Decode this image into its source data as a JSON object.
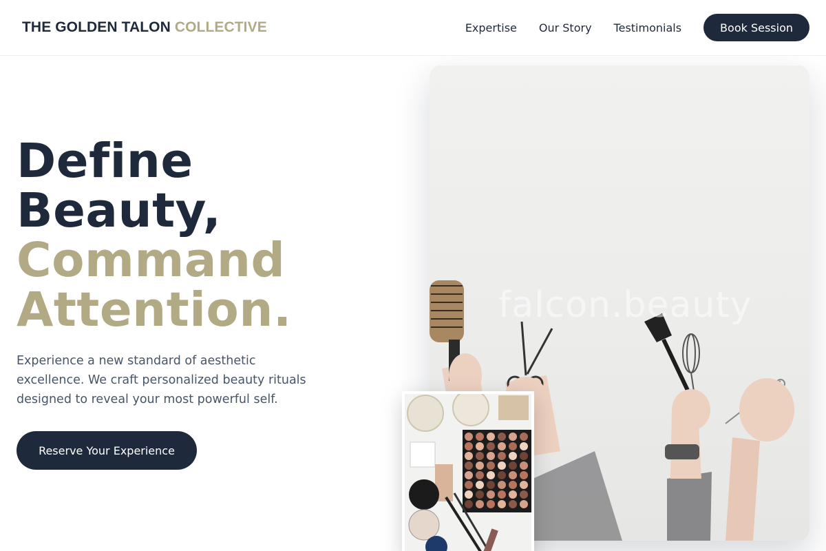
{
  "brand": {
    "name_primary": "THE GOLDEN TALON",
    "name_accent": "COLLECTIVE"
  },
  "nav": {
    "items": [
      "Expertise",
      "Our Story",
      "Testimonials"
    ],
    "cta_label": "Book Session"
  },
  "hero": {
    "headline_lines": [
      "Define",
      "Beauty,",
      "Command",
      "Attention."
    ],
    "description": "Experience a new standard of aesthetic excellence. We craft personalized beauty rituals designed to reveal your most powerful self.",
    "cta_label": "Reserve Your Experience",
    "image_watermark": "falcon.beauty"
  },
  "colors": {
    "navy": "#1e293b",
    "gold": "#b1aa85",
    "body_text": "#475569",
    "border": "#eceef1"
  },
  "icons": [
    "hair-brush",
    "scissors",
    "tint-brush",
    "whisk",
    "shears",
    "eyeshadow-palette"
  ]
}
